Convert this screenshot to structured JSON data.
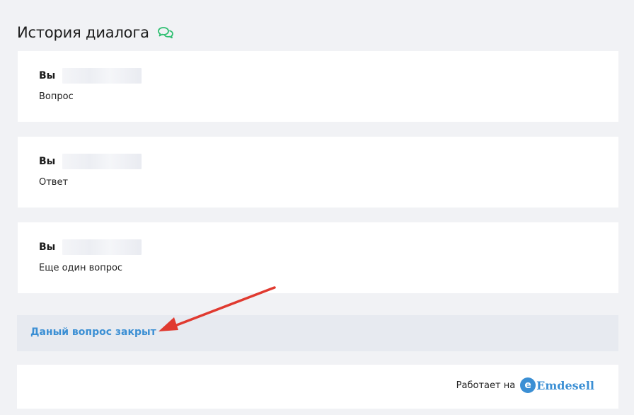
{
  "header": {
    "title": "История диалога",
    "icon": "chat-bubbles-icon",
    "icon_color": "#2fbf71"
  },
  "messages": [
    {
      "author": "Вы",
      "text": "Вопрос"
    },
    {
      "author": "Вы",
      "text": "Ответ"
    },
    {
      "author": "Вы",
      "text": "Еще один вопрос"
    }
  ],
  "status": {
    "closed_text": "Даный вопрос закрыт",
    "color": "#3b8fd4"
  },
  "footer": {
    "powered_label": "Работает на",
    "brand_letter": "e",
    "brand_name": "Emdesell",
    "brand_color": "#3b8fd4"
  },
  "annotation": {
    "arrow_color": "#e03a30"
  }
}
